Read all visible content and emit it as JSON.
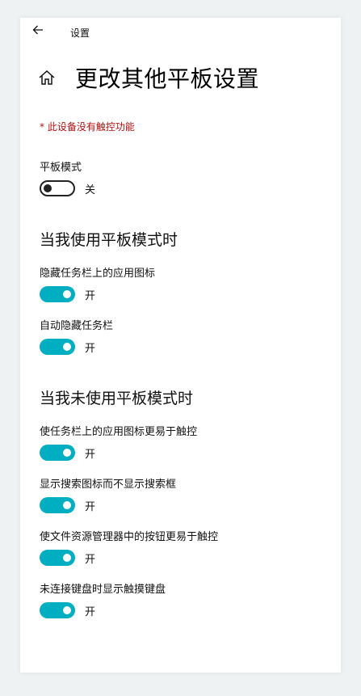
{
  "window": {
    "title": "设置",
    "back_icon": "back-arrow-icon"
  },
  "header": {
    "icon": "home-icon",
    "title": "更改其他平板设置"
  },
  "warning": "* 此设备没有触控功能",
  "tablet_mode": {
    "label": "平板模式",
    "on": false,
    "state": "关"
  },
  "section_tablet_on": {
    "title": "当我使用平板模式时",
    "settings": [
      {
        "label": "隐藏任务栏上的应用图标",
        "on": true,
        "state": "开"
      },
      {
        "label": "自动隐藏任务栏",
        "on": true,
        "state": "开"
      }
    ]
  },
  "section_tablet_off": {
    "title": "当我未使用平板模式时",
    "settings": [
      {
        "label": "使任务栏上的应用图标更易于触控",
        "on": true,
        "state": "开"
      },
      {
        "label": "显示搜索图标而不显示搜索框",
        "on": true,
        "state": "开"
      },
      {
        "label": "使文件资源管理器中的按钮更易于触控",
        "on": true,
        "state": "开"
      },
      {
        "label": "未连接键盘时显示触摸键盘",
        "on": true,
        "state": "开"
      }
    ]
  },
  "colors": {
    "accent": "#00aec2",
    "warning": "#b01010"
  }
}
